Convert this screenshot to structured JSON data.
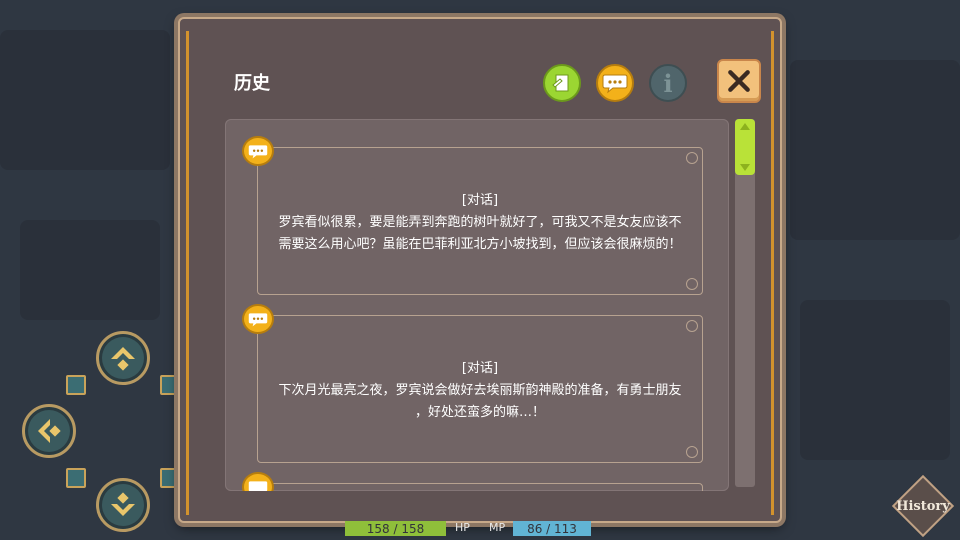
{
  "dialog": {
    "title": "历史",
    "info_icon_glyph": "i"
  },
  "entries": [
    {
      "tag": "[对话]",
      "line1": "罗宾看似很累，要是能弄到奔跑的树叶就好了，可我又不是女友应该不",
      "line2": "需要这么用心吧？虽能在巴菲利亚北方小坡找到，但应该会很麻烦的！"
    },
    {
      "tag": "[对话]",
      "line1": "下次月光最亮之夜，罗宾说会做好去埃丽斯韵神殿的准备，有勇士朋友",
      "line2": "，好处还蛮多的嘛…！"
    }
  ],
  "stats": {
    "hp_value": "158 / 158",
    "hp_label": "HP",
    "mp_label": "MP",
    "mp_value": "86 / 113"
  },
  "history_button": {
    "label": "History"
  },
  "colors": {
    "accent_gold": "#d3922d",
    "chat_yellow": "#f3b11a",
    "log_green": "#9bd632",
    "scroll_green": "#b9e238",
    "hp_green": "#8fbf3a",
    "mp_blue": "#61b4d4"
  },
  "icons": {
    "log": "log-icon",
    "chat": "chat-bubble-icon",
    "info": "info-icon",
    "close": "close-icon",
    "scroll_up": "triangle-up-icon",
    "scroll_down": "triangle-down-icon"
  }
}
